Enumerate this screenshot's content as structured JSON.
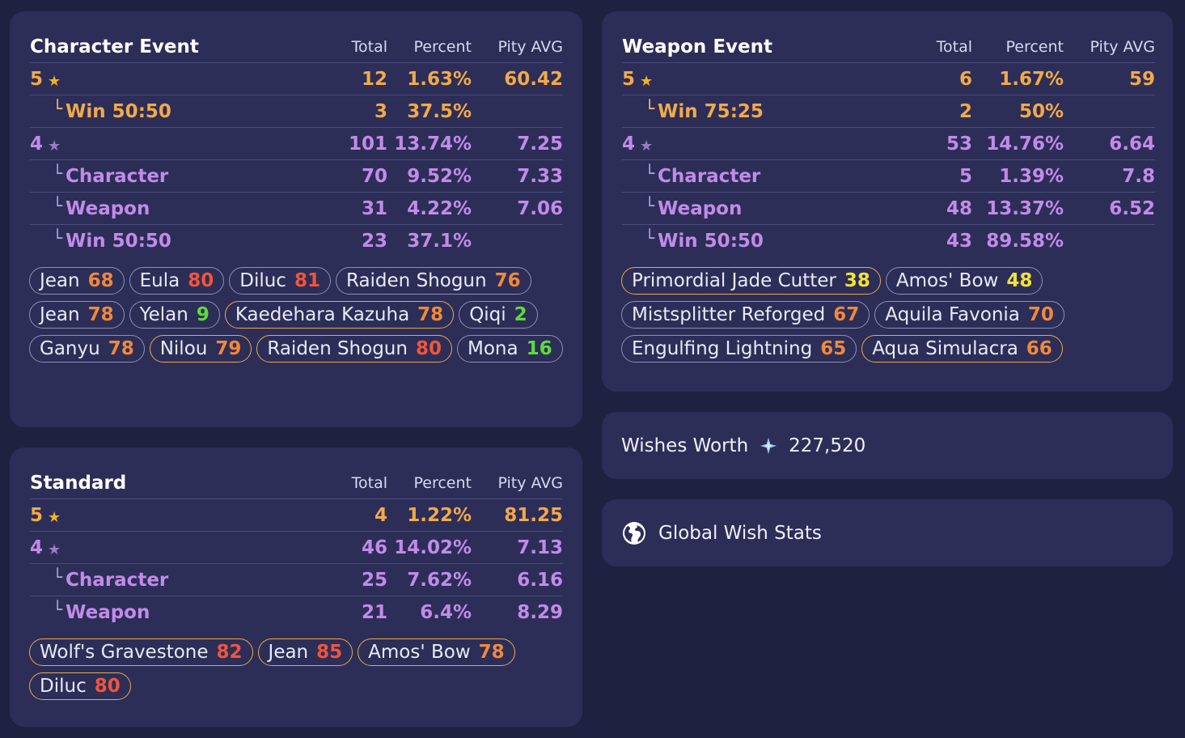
{
  "colors": {
    "background": "#1f2140",
    "card": "#2c2e58",
    "five_star": "#f2a94a",
    "four_star": "#c28be6",
    "pity_red": "#f0553c",
    "pity_orange": "#f0883c",
    "pity_yellow": "#f2e23a",
    "pity_green": "#5edb3c"
  },
  "headers": {
    "total": "Total",
    "percent": "Percent",
    "pity": "Pity AVG"
  },
  "character_event": {
    "title": "Character Event",
    "rows": [
      {
        "label": "5",
        "total": "12",
        "percent": "1.63%",
        "pity": "60.42"
      },
      {
        "label": "Win 50:50",
        "total": "3",
        "percent": "37.5%",
        "pity": ""
      },
      {
        "label": "4",
        "total": "101",
        "percent": "13.74%",
        "pity": "7.25"
      },
      {
        "label": "Character",
        "total": "70",
        "percent": "9.52%",
        "pity": "7.33"
      },
      {
        "label": "Weapon",
        "total": "31",
        "percent": "4.22%",
        "pity": "7.06"
      },
      {
        "label": "Win 50:50",
        "total": "23",
        "percent": "37.1%",
        "pity": ""
      }
    ],
    "chips": [
      {
        "name": "Jean",
        "pity": "68"
      },
      {
        "name": "Eula",
        "pity": "80"
      },
      {
        "name": "Diluc",
        "pity": "81"
      },
      {
        "name": "Raiden Shogun",
        "pity": "76"
      },
      {
        "name": "Jean",
        "pity": "78"
      },
      {
        "name": "Yelan",
        "pity": "9"
      },
      {
        "name": "Kaedehara Kazuha",
        "pity": "78"
      },
      {
        "name": "Qiqi",
        "pity": "2"
      },
      {
        "name": "Ganyu",
        "pity": "78"
      },
      {
        "name": "Nilou",
        "pity": "79"
      },
      {
        "name": "Raiden Shogun",
        "pity": "80"
      },
      {
        "name": "Mona",
        "pity": "16"
      }
    ]
  },
  "weapon_event": {
    "title": "Weapon Event",
    "rows": [
      {
        "label": "5",
        "total": "6",
        "percent": "1.67%",
        "pity": "59"
      },
      {
        "label": "Win 75:25",
        "total": "2",
        "percent": "50%",
        "pity": ""
      },
      {
        "label": "4",
        "total": "53",
        "percent": "14.76%",
        "pity": "6.64"
      },
      {
        "label": "Character",
        "total": "5",
        "percent": "1.39%",
        "pity": "7.8"
      },
      {
        "label": "Weapon",
        "total": "48",
        "percent": "13.37%",
        "pity": "6.52"
      },
      {
        "label": "Win 50:50",
        "total": "43",
        "percent": "89.58%",
        "pity": ""
      }
    ],
    "chips": [
      {
        "name": "Primordial Jade Cutter",
        "pity": "38"
      },
      {
        "name": "Amos' Bow",
        "pity": "48"
      },
      {
        "name": "Mistsplitter Reforged",
        "pity": "67"
      },
      {
        "name": "Aquila Favonia",
        "pity": "70"
      },
      {
        "name": "Engulfing Lightning",
        "pity": "65"
      },
      {
        "name": "Aqua Simulacra",
        "pity": "66"
      }
    ]
  },
  "standard": {
    "title": "Standard",
    "rows": [
      {
        "label": "5",
        "total": "4",
        "percent": "1.22%",
        "pity": "81.25"
      },
      {
        "label": "4",
        "total": "46",
        "percent": "14.02%",
        "pity": "7.13"
      },
      {
        "label": "Character",
        "total": "25",
        "percent": "7.62%",
        "pity": "6.16"
      },
      {
        "label": "Weapon",
        "total": "21",
        "percent": "6.4%",
        "pity": "8.29"
      }
    ],
    "chips": [
      {
        "name": "Wolf's Gravestone",
        "pity": "82"
      },
      {
        "name": "Jean",
        "pity": "85"
      },
      {
        "name": "Amos' Bow",
        "pity": "78"
      },
      {
        "name": "Diluc",
        "pity": "80"
      }
    ]
  },
  "wishes_worth": {
    "label": "Wishes Worth",
    "icon": "primogem-icon",
    "value": "227,520"
  },
  "global_stats": {
    "label": "Global Wish Stats",
    "icon": "globe-icon"
  }
}
